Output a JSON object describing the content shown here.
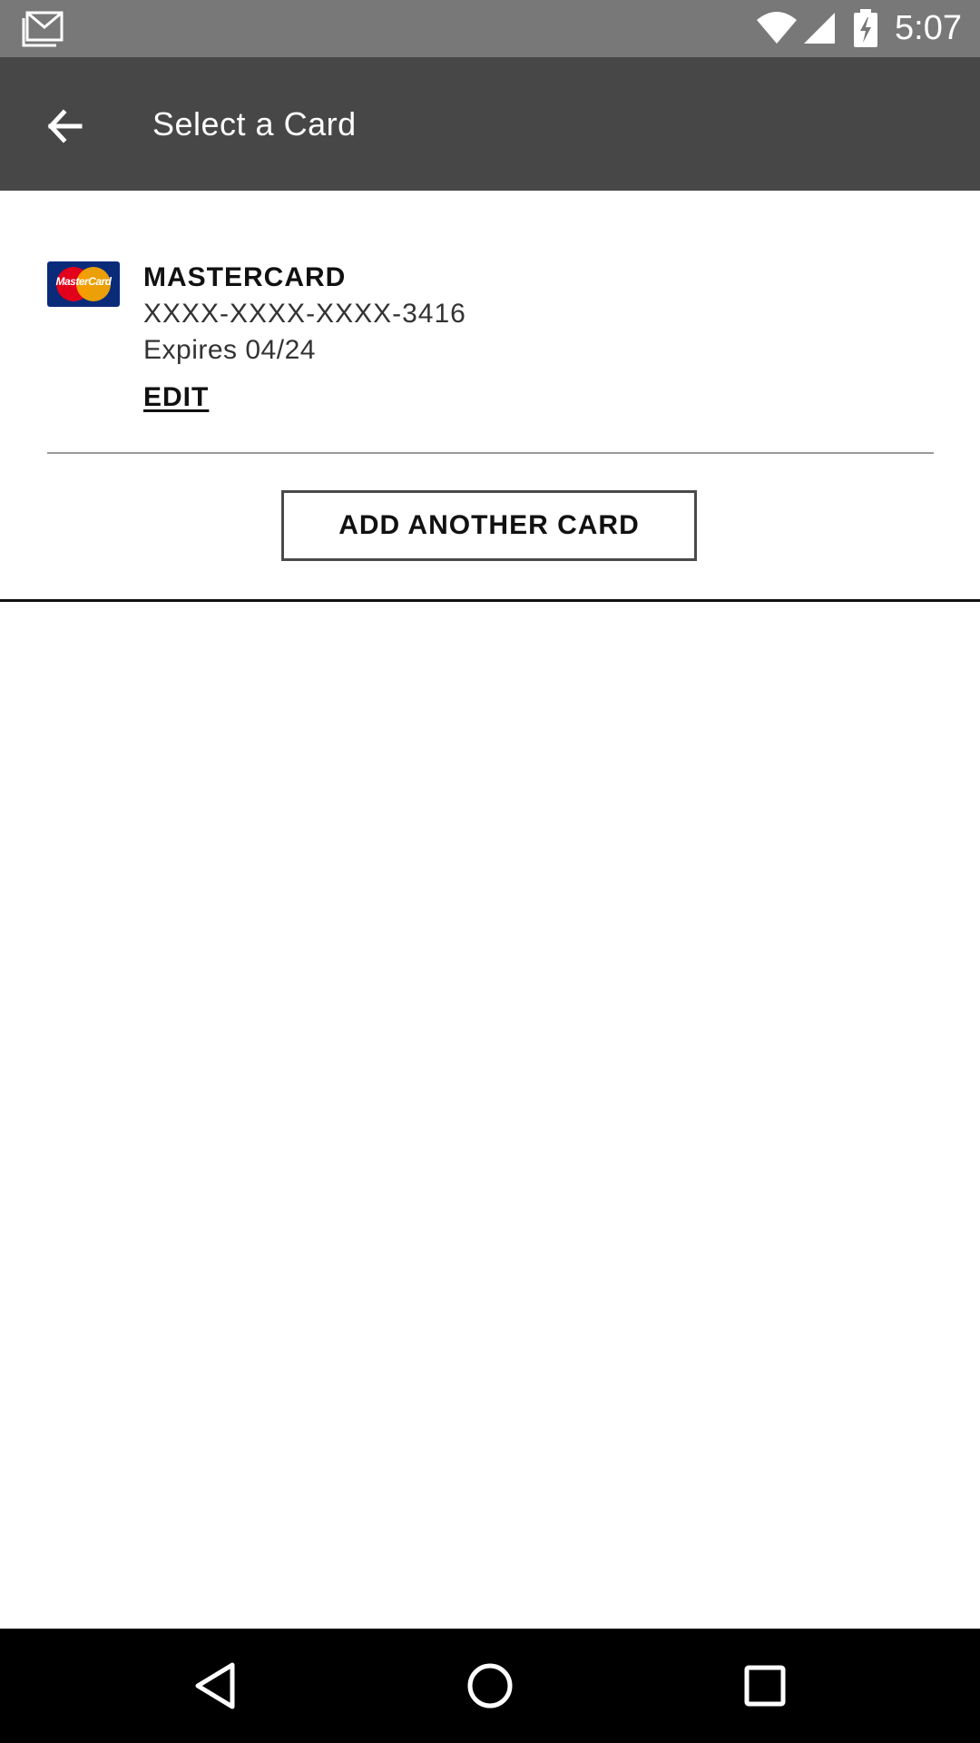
{
  "status_bar": {
    "time": "5:07",
    "icons": [
      "gmail-icon",
      "wifi-icon",
      "signal-icon",
      "battery-charging-icon"
    ]
  },
  "app_bar": {
    "title": "Select a Card",
    "back_icon": "arrow-left-icon"
  },
  "card": {
    "brand": "MASTERCARD",
    "logo_text": "MasterCard",
    "number": "XXXX-XXXX-XXXX-3416",
    "expiry": "Expires 04/24",
    "edit_label": "EDIT"
  },
  "add_card_button": {
    "label": "ADD ANOTHER CARD"
  },
  "nav_bar": {
    "icons": [
      "nav-back-icon",
      "nav-home-icon",
      "nav-recents-icon"
    ]
  },
  "colors": {
    "status_bar": "#787878",
    "app_bar": "#474747",
    "mastercard_blue": "#0a2a7a",
    "mastercard_red": "#e3001b",
    "mastercard_orange": "#f7a600"
  }
}
